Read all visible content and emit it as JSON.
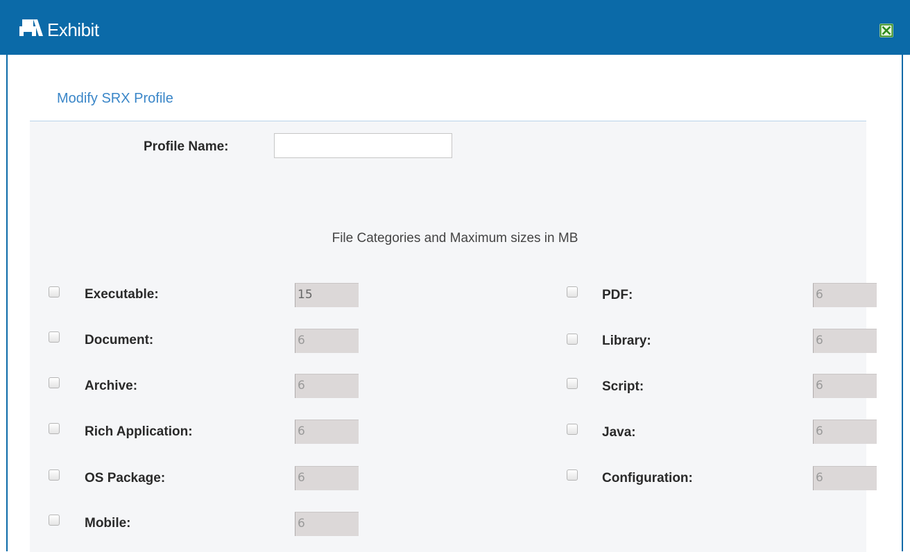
{
  "window": {
    "title": "Exhibit",
    "title_icon": "printer-icon",
    "close_icon": "close-icon",
    "accent_color": "#0b6aa8"
  },
  "form": {
    "heading": "Modify SRX Profile",
    "profile_name": {
      "label": "Profile Name:",
      "value": ""
    },
    "categories_heading": "File Categories and Maximum sizes in MB",
    "left_column": [
      {
        "label": "Executable:",
        "size": "15",
        "checked": false
      },
      {
        "label": "Document:",
        "size": "6",
        "checked": false
      },
      {
        "label": "Archive:",
        "size": "6",
        "checked": false
      },
      {
        "label": "Rich Application:",
        "size": "6",
        "checked": false
      },
      {
        "label": "OS Package:",
        "size": "6",
        "checked": false
      },
      {
        "label": "Mobile:",
        "size": "6",
        "checked": false
      }
    ],
    "right_column": [
      {
        "label": "PDF:",
        "size": "6",
        "checked": false
      },
      {
        "label": "Library:",
        "size": "6",
        "checked": false
      },
      {
        "label": "Script:",
        "size": "6",
        "checked": false
      },
      {
        "label": "Java:",
        "size": "6",
        "checked": false
      },
      {
        "label": "Configuration:",
        "size": "6",
        "checked": false
      }
    ]
  }
}
